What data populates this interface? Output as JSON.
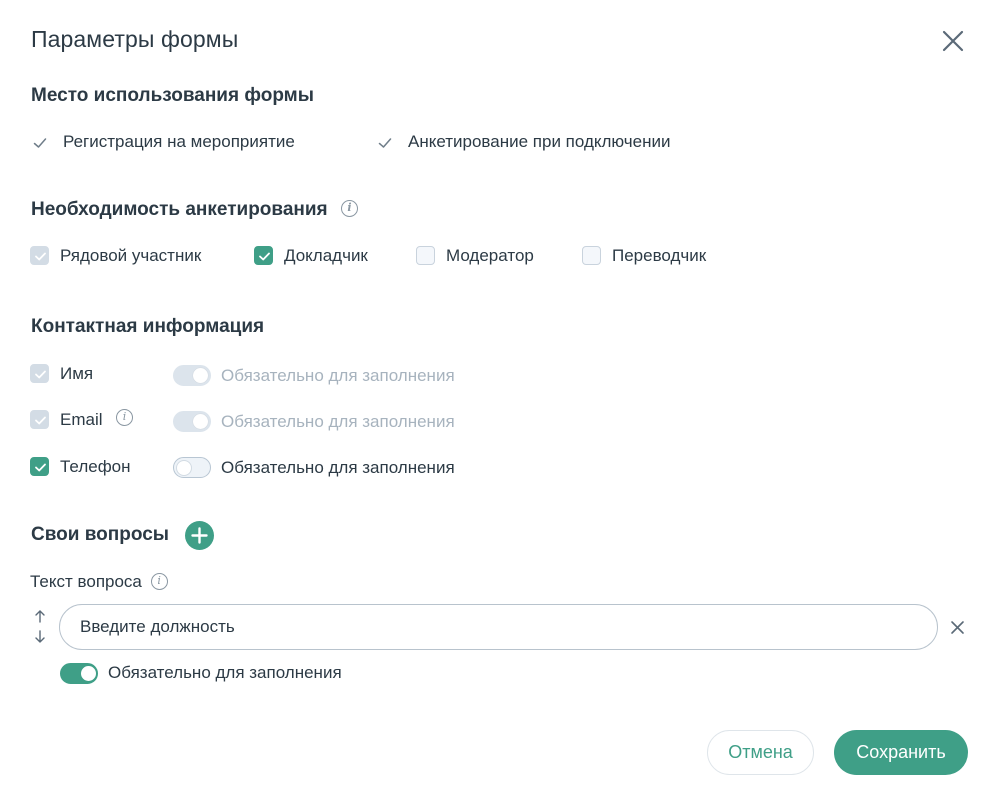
{
  "title": "Параметры формы",
  "usage": {
    "heading": "Место использования формы",
    "items": [
      "Регистрация на мероприятие",
      "Анкетирование при подключении"
    ]
  },
  "survey": {
    "heading": "Необходимость анкетирования",
    "info_icon": "info-icon",
    "roles": [
      {
        "label": "Рядовой участник",
        "state": "checked-disabled"
      },
      {
        "label": "Докладчик",
        "state": "checked"
      },
      {
        "label": "Модератор",
        "state": "unchecked"
      },
      {
        "label": "Переводчик",
        "state": "unchecked"
      }
    ]
  },
  "contacts": {
    "heading": "Контактная информация",
    "fields": [
      {
        "label": "Имя",
        "checkbox": "checked-disabled",
        "required_label": "Обязательно для заполнения",
        "required": true,
        "toggle_disabled": true
      },
      {
        "label": "Email",
        "checkbox": "checked-disabled",
        "required_label": "Обязательно для заполнения",
        "required": true,
        "toggle_disabled": true
      },
      {
        "label": "Телефон",
        "checkbox": "checked",
        "required_label": "Обязательно для заполнения",
        "required": false,
        "toggle_disabled": false
      }
    ]
  },
  "custom_questions": {
    "heading": "Свои вопросы",
    "question_label": "Текст вопроса",
    "question_value": "Введите должность",
    "required_label": "Обязательно для заполнения",
    "required": true
  },
  "buttons": {
    "cancel": "Отмена",
    "save": "Сохранить"
  },
  "colors": {
    "accent": "#3f9f87",
    "text": "#2c3a45",
    "muted": "#a7b3be",
    "disabled_fill": "#d3dce5"
  }
}
